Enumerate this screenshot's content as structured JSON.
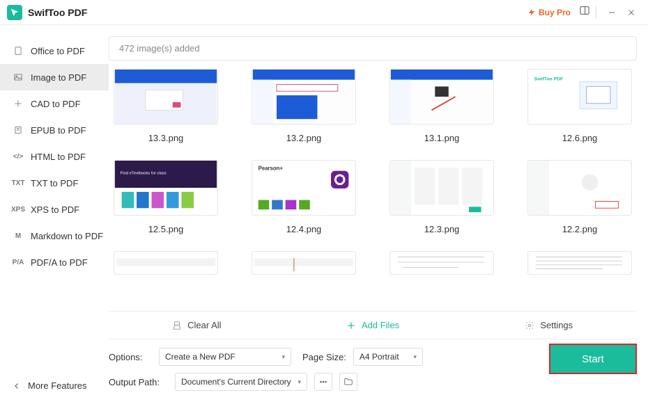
{
  "app": {
    "name": "SwifToo PDF",
    "buy_pro": "Buy Pro"
  },
  "sidebar": {
    "items": [
      {
        "label": "Office to PDF"
      },
      {
        "label": "Image to PDF"
      },
      {
        "label": "CAD to PDF"
      },
      {
        "label": "EPUB to PDF"
      },
      {
        "label": "HTML to PDF"
      },
      {
        "label": "TXT to PDF"
      },
      {
        "label": "XPS to PDF"
      },
      {
        "label": "Markdown to PDF"
      },
      {
        "label": "PDF/A to PDF"
      }
    ],
    "selected_index": 1,
    "more": "More Features"
  },
  "content": {
    "count_text": "472 image(s) added",
    "thumbs": [
      {
        "label": "13.3.png"
      },
      {
        "label": "13.2.png"
      },
      {
        "label": "13.1.png"
      },
      {
        "label": "12.6.png"
      },
      {
        "label": "12.5.png"
      },
      {
        "label": "12.4.png"
      },
      {
        "label": "12.3.png"
      },
      {
        "label": "12.2.png"
      }
    ]
  },
  "toolbar": {
    "clear": "Clear All",
    "add": "Add Files",
    "settings": "Settings"
  },
  "options": {
    "options_label": "Options:",
    "options_value": "Create a New PDF",
    "page_size_label": "Page Size:",
    "page_size_value": "A4 Portrait",
    "output_label": "Output Path:",
    "output_value": "Document's Current Directory",
    "start": "Start"
  }
}
